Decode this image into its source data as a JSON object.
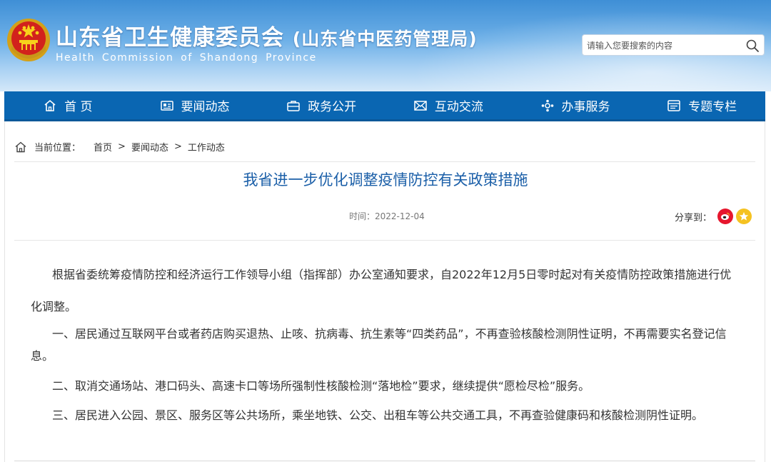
{
  "header": {
    "title": "山东省卫生健康委员会",
    "subtitle": "(山东省中医药管理局)",
    "english": "Health Commission  of  Shandong  Province",
    "search_placeholder": "请输入您要搜索的内容"
  },
  "nav": {
    "items": [
      {
        "label": "首 页",
        "icon": "home-icon"
      },
      {
        "label": "要闻动态",
        "icon": "news-icon"
      },
      {
        "label": "政务公开",
        "icon": "briefcase-icon"
      },
      {
        "label": "互动交流",
        "icon": "envelope-icon"
      },
      {
        "label": "办事服务",
        "icon": "service-icon"
      },
      {
        "label": "专题专栏",
        "icon": "column-icon"
      }
    ]
  },
  "breadcrumb": {
    "label": "当前位置：",
    "items": [
      "首页",
      "要闻动态",
      "工作动态"
    ],
    "separator": ">"
  },
  "article": {
    "title": "我省进一步优化调整疫情防控有关政策措施",
    "time": "时间：2022-12-04",
    "share_label": "分享到：",
    "paragraphs": [
      "根据省委统筹疫情防控和经济运行工作领导小组（指挥部）办公室通知要求，自2022年12月5日零时起对有关疫情防控政策措施进行优化调整。",
      "一、居民通过互联网平台或者药店购买退热、止咳、抗病毒、抗生素等“四类药品”，不再查验核酸检测阴性证明，不再需要实名登记信息。",
      "二、取消交通场站、港口码头、高速卡口等场所强制性核酸检测“落地检”要求，继续提供“愿检尽检”服务。",
      "三、居民进入公园、景区、服务区等公共场所，乘坐地铁、公交、出租车等公共交通工具，不再查验健康码和核酸检测阴性证明。"
    ]
  },
  "colors": {
    "nav_bg": "#0a66b2",
    "title_blue": "#1b5fa8",
    "weibo_red": "#e6162d",
    "qzone_yellow": "#f5c221"
  }
}
